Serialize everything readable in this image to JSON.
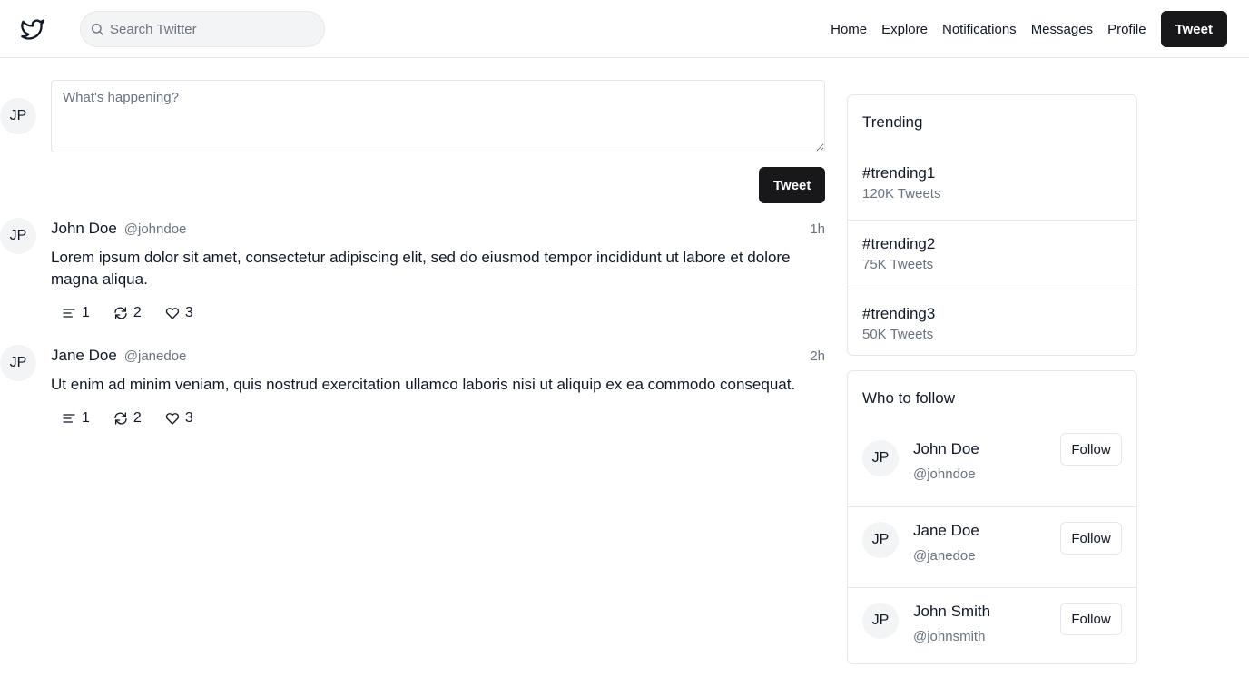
{
  "header": {
    "logo_icon": "bird-icon",
    "search": {
      "placeholder": "Search Twitter",
      "value": ""
    },
    "nav": [
      "Home",
      "Explore",
      "Notifications",
      "Messages",
      "Profile"
    ],
    "tweet_button": "Tweet"
  },
  "composer": {
    "avatar_initials": "JP",
    "placeholder": "What's happening?",
    "submit_label": "Tweet"
  },
  "feed": [
    {
      "avatar_initials": "JP",
      "name": "John Doe",
      "handle": "@johndoe",
      "time": "1h",
      "text": "Lorem ipsum dolor sit amet, consectetur adipiscing elit, sed do eiusmod tempor incididunt ut labore et dolore magna aliqua.",
      "replies": "1",
      "retweets": "2",
      "likes": "3"
    },
    {
      "avatar_initials": "JP",
      "name": "Jane Doe",
      "handle": "@janedoe",
      "time": "2h",
      "text": "Ut enim ad minim veniam, quis nostrud exercitation ullamco laboris nisi ut aliquip ex ea commodo consequat.",
      "replies": "1",
      "retweets": "2",
      "likes": "3"
    }
  ],
  "trending": {
    "title": "Trending",
    "items": [
      {
        "tag": "#trending1",
        "count": "120K Tweets"
      },
      {
        "tag": "#trending2",
        "count": "75K Tweets"
      },
      {
        "tag": "#trending3",
        "count": "50K Tweets"
      }
    ]
  },
  "who_to_follow": {
    "title": "Who to follow",
    "items": [
      {
        "avatar_initials": "JP",
        "name": "John Doe",
        "handle": "@johndoe",
        "button": "Follow"
      },
      {
        "avatar_initials": "JP",
        "name": "Jane Doe",
        "handle": "@janedoe",
        "button": "Follow"
      },
      {
        "avatar_initials": "JP",
        "name": "John Smith",
        "handle": "@johnsmith",
        "button": "Follow"
      }
    ]
  }
}
